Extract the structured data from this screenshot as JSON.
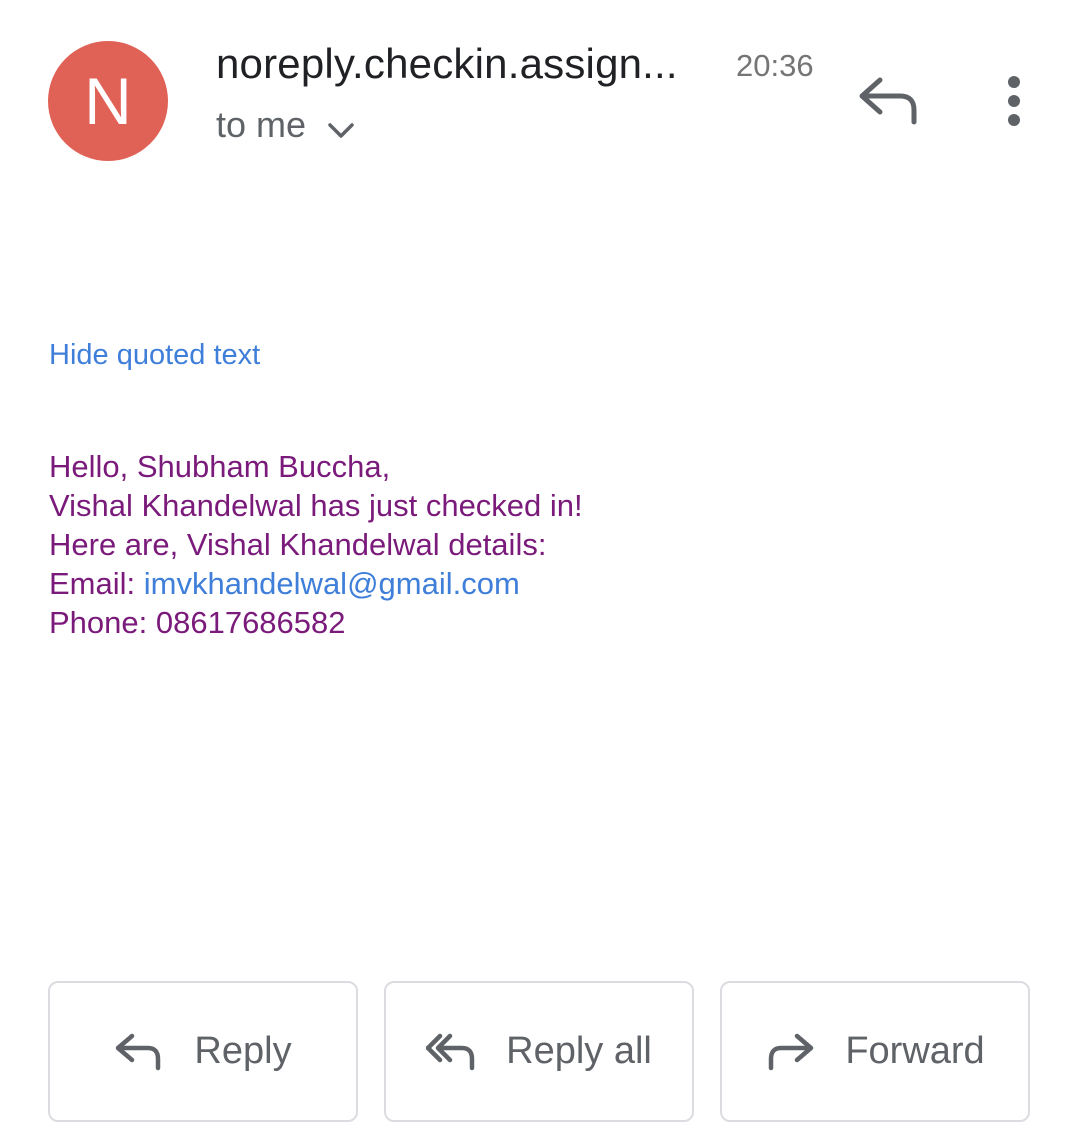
{
  "header": {
    "avatar_letter": "N",
    "avatar_color": "#e06155",
    "sender": "noreply.checkin.assign...",
    "time": "20:36",
    "recipient": "to me"
  },
  "icons": {
    "expand": "chevron-down-icon",
    "reply": "reply-icon",
    "more": "more-vert-icon",
    "reply_all": "reply-all-icon",
    "forward": "forward-icon"
  },
  "message": {
    "hide_quoted": "Hide quoted text",
    "greeting": "Hello, Shubham Buccha,",
    "line1": "Vishal Khandelwal has just checked in!",
    "line2": "Here are, Vishal Khandelwal details:",
    "email_label": "Email: ",
    "email_value": "imvkhandelwal@gmail.com",
    "phone_line": "Phone: 08617686582",
    "text_color": "#7a1a7a",
    "link_color": "#3f7fd9"
  },
  "actions": {
    "reply": "Reply",
    "reply_all": "Reply all",
    "forward": "Forward"
  }
}
